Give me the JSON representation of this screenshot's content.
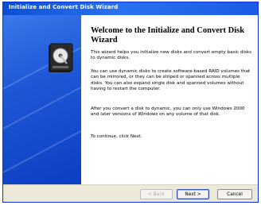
{
  "window": {
    "title": "Initialize and Convert Disk Wizard"
  },
  "welcome": {
    "heading": "Welcome to the Initialize and Convert Disk Wizard",
    "intro": "This wizard helps you initialize new disks and convert empty basic disks to dynamic disks.",
    "para1": "You can use dynamic disks to create software-based RAID volumes that can be mirrored, or they can be striped or spanned across multiple disks. You can also expand single disk and spanned volumes without having to restart the computer.",
    "para2": "After you convert a disk to dynamic, you can only use Windows 2000 and later versions of Windows on any volume of that disk.",
    "para3": "To continue, click Next."
  },
  "buttons": {
    "back": "< Back",
    "next": "Next >",
    "cancel": "Cancel"
  },
  "icons": {
    "banner_icon": "hard-disk-wizard-icon"
  },
  "colors": {
    "titlebar": "#0a4fd1",
    "banner": "#1d57d6",
    "button_face": "#ece9d8"
  }
}
